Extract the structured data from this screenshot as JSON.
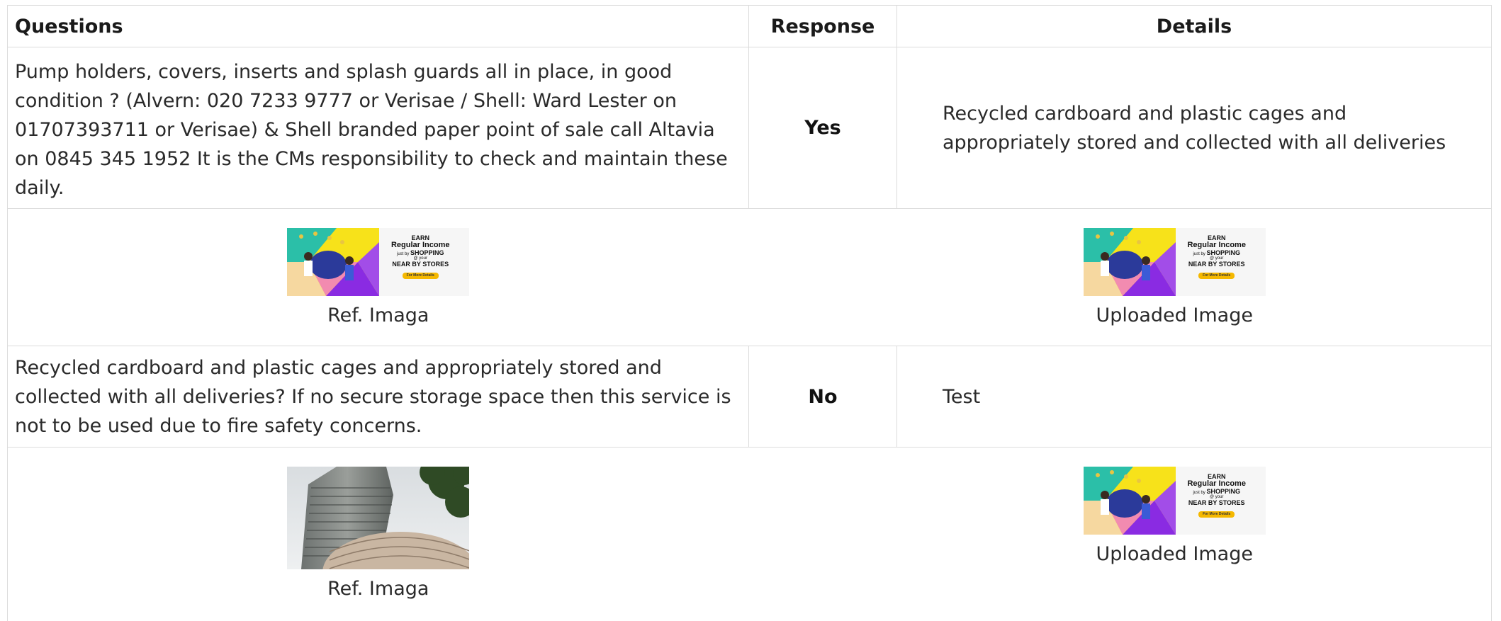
{
  "table": {
    "headers": {
      "questions": "Questions",
      "response": "Response",
      "details": "Details"
    },
    "rows": [
      {
        "question": "Pump holders, covers, inserts and splash guards all in place, in good condition ? (Alvern: 020 7233 9777 or Verisae / Shell: Ward Lester on 01707393711 or Verisae) & Shell branded paper point of sale call Altavia on 0845 345 1952 It is the CMs responsibility to check and maintain these daily.",
        "response": "Yes",
        "details": "Recycled cardboard and plastic cages and appropriately stored and collected with all deliveries",
        "ref_caption": "Ref. Imaga",
        "uploaded_caption": "Uploaded Image"
      },
      {
        "question": "Recycled cardboard and plastic cages and appropriately stored and collected with all deliveries? If no secure storage space then this service is not to be used due to fire safety concerns.",
        "response": "No",
        "details": "Test",
        "ref_caption": "Ref. Imaga",
        "uploaded_caption": "Uploaded Image"
      }
    ]
  },
  "banner": {
    "line1": "EARN",
    "line2": "Regular Income",
    "line3": "just by",
    "line4": "SHOPPING",
    "line5": "@ your",
    "line6": "NEAR BY STORES",
    "button": "For More Details"
  },
  "colors": {
    "border": "#dcdcdc",
    "banner_teal": "#2bbfa8",
    "banner_yellow": "#f7e21a",
    "banner_purple": "#8a2be2",
    "banner_pink": "#f28bb0",
    "banner_button": "#f5b800"
  }
}
